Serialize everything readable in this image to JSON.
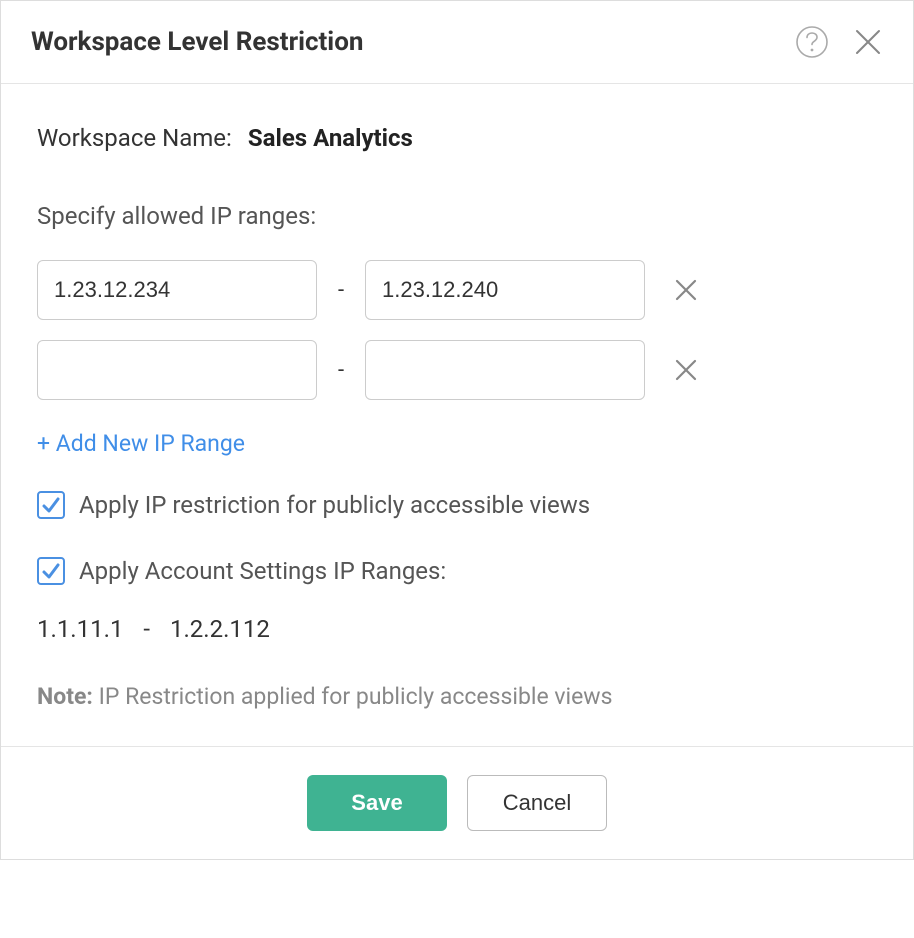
{
  "dialog": {
    "title": "Workspace Level Restriction"
  },
  "workspace": {
    "label": "Workspace Name:",
    "name": "Sales Analytics"
  },
  "ip_section": {
    "label": "Specify allowed IP ranges:",
    "ranges": [
      {
        "from": "1.23.12.234",
        "to": "1.23.12.240"
      },
      {
        "from": "",
        "to": ""
      }
    ],
    "add_link": "+ Add New IP Range"
  },
  "options": {
    "public_views_label": "Apply IP restriction for publicly accessible views",
    "account_ranges_label": "Apply Account Settings IP Ranges:"
  },
  "account_range": {
    "from": "1.1.11.1",
    "to": "1.2.2.112"
  },
  "note": {
    "label": "Note:",
    "text": " IP Restriction applied for publicly accessible views"
  },
  "footer": {
    "save": "Save",
    "cancel": "Cancel"
  }
}
